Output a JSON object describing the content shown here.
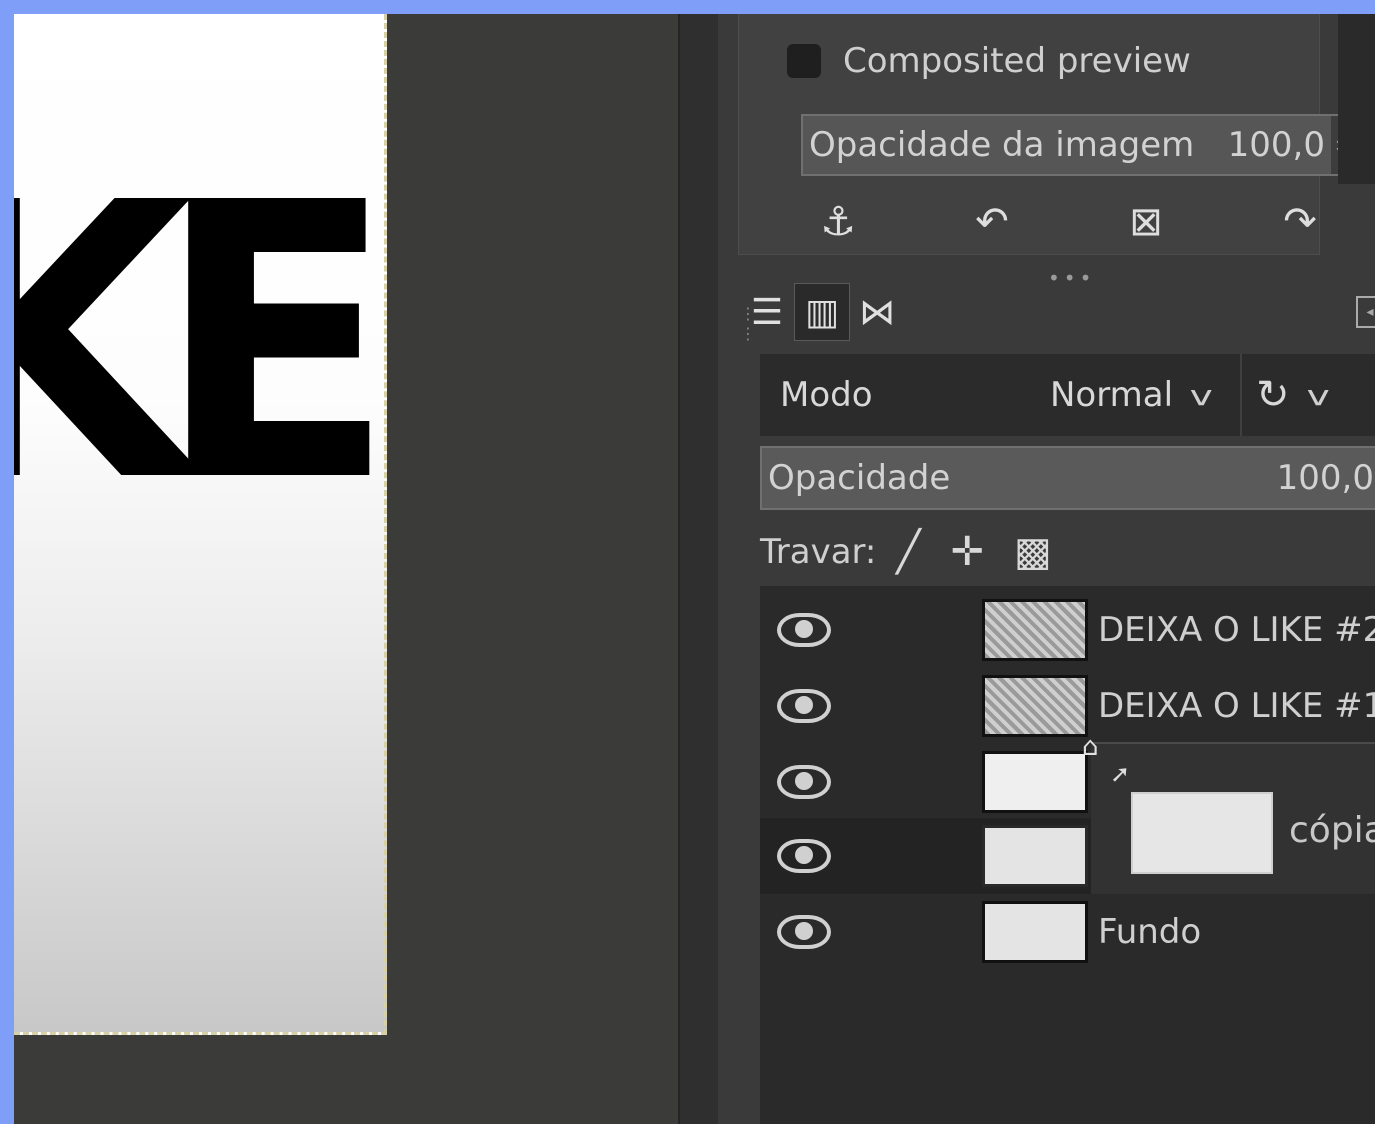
{
  "canvas": {
    "visible_text": "KE"
  },
  "upper_panel": {
    "composited_preview_label": "Composited preview",
    "image_opacity": {
      "label": "Opacidade da imagem",
      "value": "100,0"
    },
    "toolbar_icons": [
      "anchor-icon",
      "undo-icon",
      "delete-icon",
      "redo-icon"
    ]
  },
  "layers_panel": {
    "tabs": [
      "layers-tab-icon",
      "channels-tab-icon",
      "paths-tab-icon"
    ],
    "mode": {
      "label": "Modo",
      "value": "Normal"
    },
    "opacity": {
      "label": "Opacidade",
      "value": "100,0"
    },
    "lock_label": "Travar:",
    "layers": [
      {
        "name": "DEIXA O LIKE #2",
        "visible": true,
        "thumb": "pattern"
      },
      {
        "name": "DEIXA O LIKE #1",
        "visible": true,
        "thumb": "pattern"
      },
      {
        "name": "",
        "visible": true,
        "thumb": "text"
      },
      {
        "name": "c",
        "visible": true,
        "thumb": "plain",
        "selected": true
      },
      {
        "name": "Fundo",
        "visible": true,
        "thumb": "plain"
      }
    ],
    "drag_ghost_label": "cópia"
  },
  "colors": {
    "outer_background": "#7e9ef7",
    "panel_dark": "#2a2a2a",
    "panel_mid": "#3a3a3a"
  }
}
